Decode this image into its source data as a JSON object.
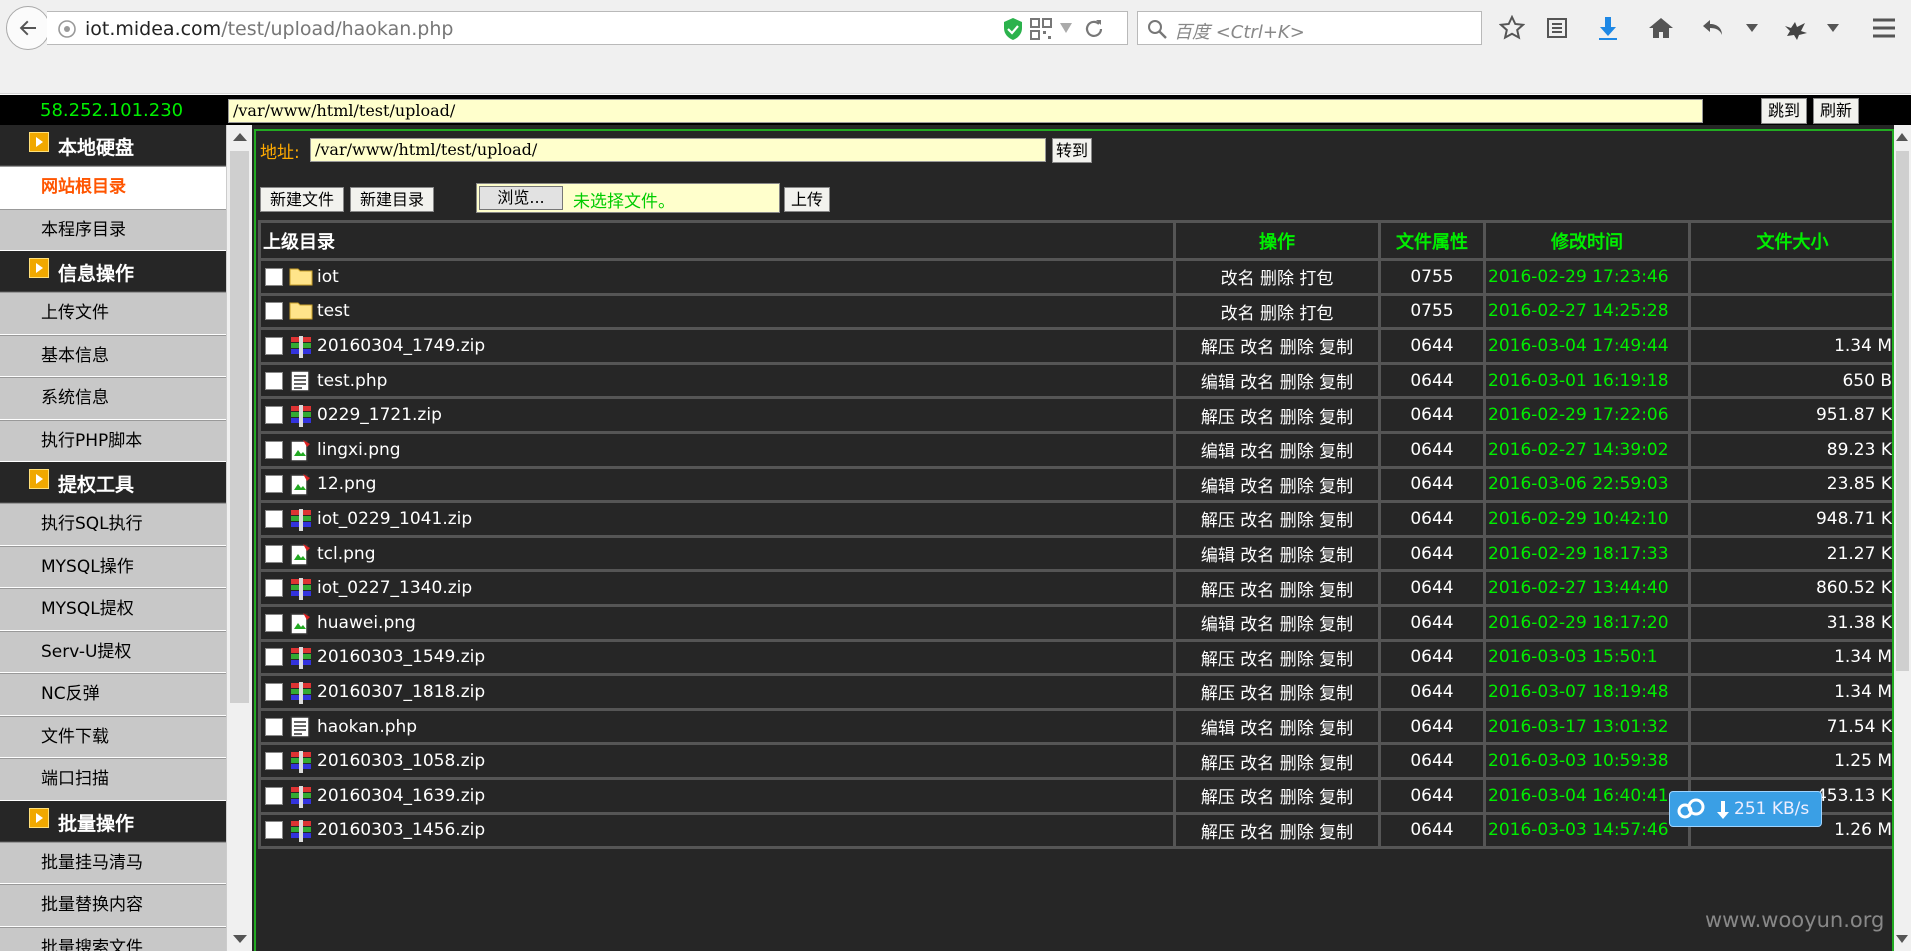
{
  "browser": {
    "url_host": "iot.midea.com",
    "url_path": "/test/upload/haokan.php",
    "search_placeholder": "百度 <Ctrl+K>"
  },
  "top": {
    "ip": "58.252.101.230",
    "path": "/var/www/html/test/upload/",
    "jump_label": "跳到",
    "refresh_label": "刷新"
  },
  "sidebar": {
    "sections": [
      {
        "title": "本地硬盘",
        "items": [
          "网站根目录",
          "本程序目录"
        ]
      },
      {
        "title": "信息操作",
        "items": [
          "上传文件",
          "基本信息",
          "系统信息",
          "执行PHP脚本"
        ]
      },
      {
        "title": "提权工具",
        "items": [
          "执行SQL执行",
          "MYSQL操作",
          "MYSQL提权",
          "Serv-U提权",
          "NC反弹",
          "文件下载",
          "端口扫描"
        ]
      },
      {
        "title": "批量操作",
        "items": [
          "批量挂马清马",
          "批量替换内容",
          "批量搜索文件"
        ]
      }
    ]
  },
  "panel": {
    "addr_label": "地址:",
    "addr_value": "/var/www/html/test/upload/",
    "goto_label": "转到",
    "new_file_label": "新建文件",
    "new_dir_label": "新建目录",
    "browse_label": "浏览...",
    "no_file_label": "未选择文件。",
    "upload_label": "上传"
  },
  "table": {
    "headers": [
      "上级目录",
      "操作",
      "文件属性",
      "修改时间",
      "文件大小"
    ],
    "rows": [
      {
        "type": "folder",
        "name": "iot",
        "ops": "改名 删除 打包",
        "perm": "0755",
        "time": "2016-02-29 17:23:46",
        "size": ""
      },
      {
        "type": "folder",
        "name": "test",
        "ops": "改名 删除 打包",
        "perm": "0755",
        "time": "2016-02-27 14:25:28",
        "size": ""
      },
      {
        "type": "zip",
        "name": "20160304_1749.zip",
        "ops": "解压 改名 删除 复制",
        "perm": "0644",
        "time": "2016-03-04 17:49:44",
        "size": "1.34 M"
      },
      {
        "type": "text",
        "name": "test.php",
        "ops": "编辑 改名 删除 复制",
        "perm": "0644",
        "time": "2016-03-01 16:19:18",
        "size": "650 B"
      },
      {
        "type": "zip",
        "name": "0229_1721.zip",
        "ops": "解压 改名 删除 复制",
        "perm": "0644",
        "time": "2016-02-29 17:22:06",
        "size": "951.87 K"
      },
      {
        "type": "image",
        "name": "lingxi.png",
        "ops": "编辑 改名 删除 复制",
        "perm": "0644",
        "time": "2016-02-27 14:39:02",
        "size": "89.23 K"
      },
      {
        "type": "image",
        "name": "12.png",
        "ops": "编辑 改名 删除 复制",
        "perm": "0644",
        "time": "2016-03-06 22:59:03",
        "size": "23.85 K"
      },
      {
        "type": "zip",
        "name": "iot_0229_1041.zip",
        "ops": "解压 改名 删除 复制",
        "perm": "0644",
        "time": "2016-02-29 10:42:10",
        "size": "948.71 K"
      },
      {
        "type": "image",
        "name": "tcl.png",
        "ops": "编辑 改名 删除 复制",
        "perm": "0644",
        "time": "2016-02-29 18:17:33",
        "size": "21.27 K"
      },
      {
        "type": "zip",
        "name": "iot_0227_1340.zip",
        "ops": "解压 改名 删除 复制",
        "perm": "0644",
        "time": "2016-02-27 13:44:40",
        "size": "860.52 K"
      },
      {
        "type": "image",
        "name": "huawei.png",
        "ops": "编辑 改名 删除 复制",
        "perm": "0644",
        "time": "2016-02-29 18:17:20",
        "size": "31.38 K"
      },
      {
        "type": "zip",
        "name": "20160303_1549.zip",
        "ops": "解压 改名 删除 复制",
        "perm": "0644",
        "time": "2016-03-03 15:50:1",
        "size": "1.34 M"
      },
      {
        "type": "zip",
        "name": "20160307_1818.zip",
        "ops": "解压 改名 删除 复制",
        "perm": "0644",
        "time": "2016-03-07 18:19:48",
        "size": "1.34 M"
      },
      {
        "type": "text",
        "name": "haokan.php",
        "ops": "编辑 改名 删除 复制",
        "perm": "0644",
        "time": "2016-03-17 13:01:32",
        "size": "71.54 K"
      },
      {
        "type": "zip",
        "name": "20160303_1058.zip",
        "ops": "解压 改名 删除 复制",
        "perm": "0644",
        "time": "2016-03-03 10:59:38",
        "size": "1.25 M"
      },
      {
        "type": "zip",
        "name": "20160304_1639.zip",
        "ops": "解压 改名 删除 复制",
        "perm": "0644",
        "time": "2016-03-04 16:40:41",
        "size": "453.13 K"
      },
      {
        "type": "zip",
        "name": "20160303_1456.zip",
        "ops": "解压 改名 删除 复制",
        "perm": "0644",
        "time": "2016-03-03 14:57:46",
        "size": "1.26 M"
      }
    ]
  },
  "overlay": {
    "speed": "251 KB/s",
    "watermark": "www.wooyun.org"
  },
  "colors": {
    "accent_green": "#00ee00",
    "active_orange": "#ff5500",
    "panel_bg": "#262626"
  }
}
